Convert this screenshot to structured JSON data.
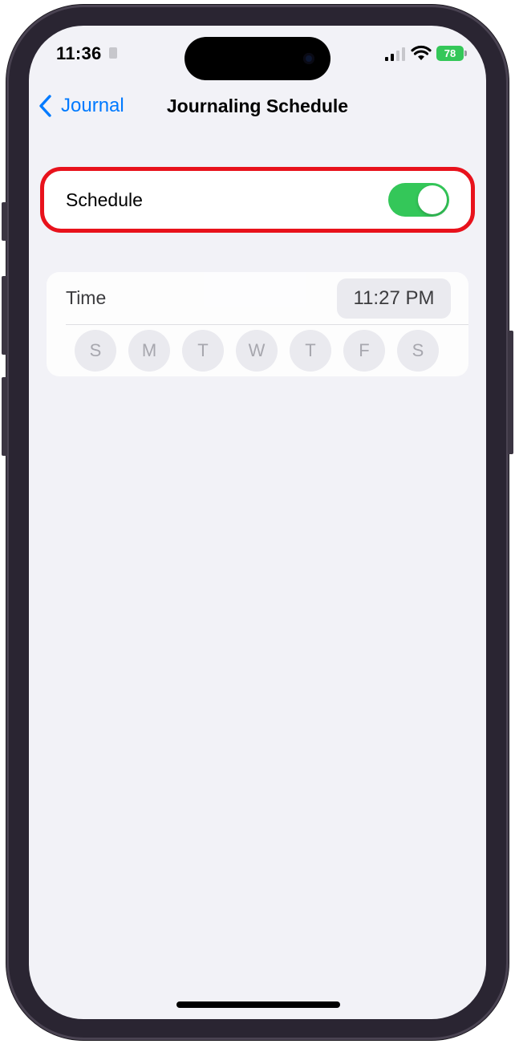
{
  "status_bar": {
    "time": "11:36",
    "battery": "78",
    "signal_icon": "cellular-signal-icon",
    "wifi_icon": "wifi-icon"
  },
  "nav": {
    "back_label": "Journal",
    "back_icon": "chevron-left-icon",
    "title": "Journaling Schedule"
  },
  "schedule": {
    "label": "Schedule",
    "toggle_on": true
  },
  "time_section": {
    "label": "Time",
    "value": "11:27 PM",
    "days": [
      "S",
      "M",
      "T",
      "W",
      "T",
      "F",
      "S"
    ]
  },
  "colors": {
    "accent": "#007aff",
    "toggle_on": "#34c759",
    "highlight": "#e8121c",
    "background": "#f2f2f7"
  }
}
